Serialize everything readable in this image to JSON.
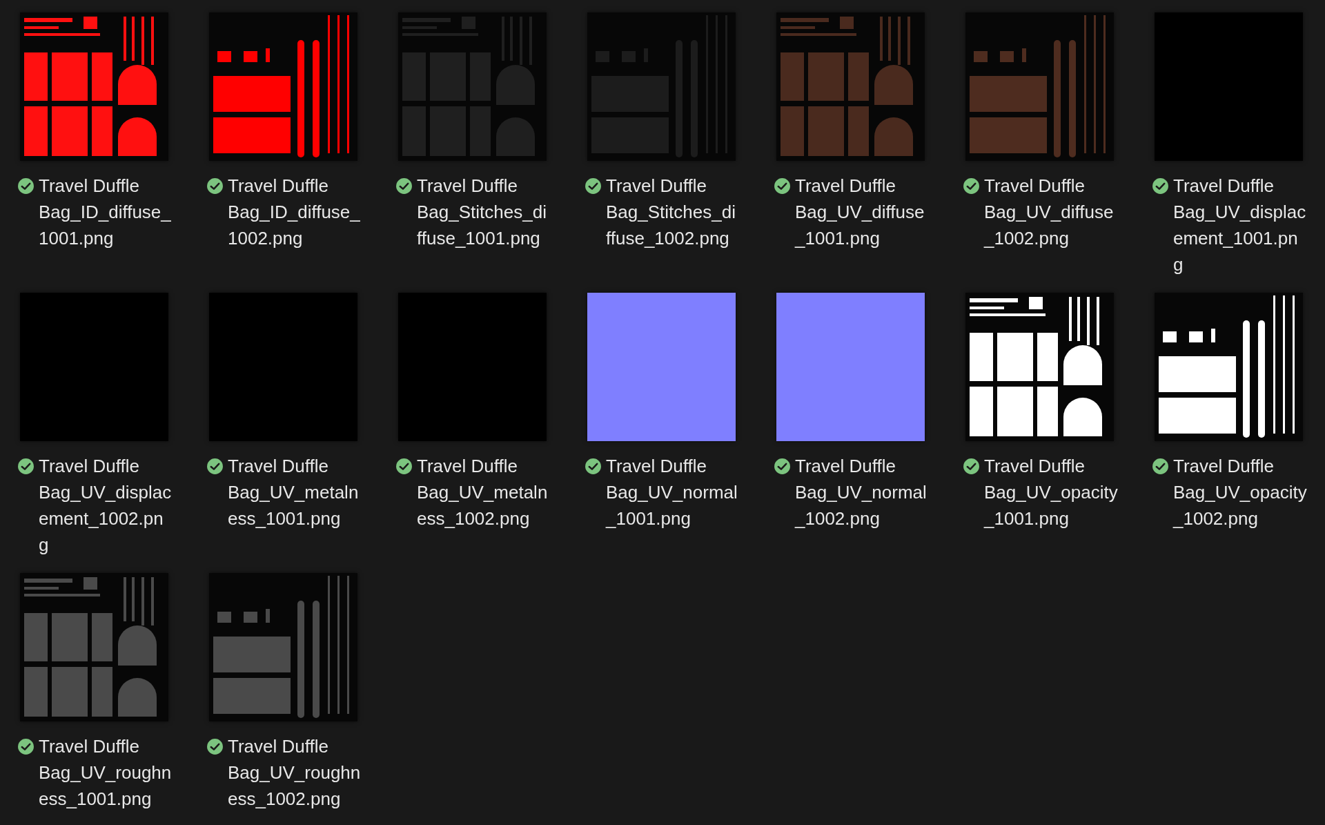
{
  "files": [
    {
      "name_lines": [
        "Travel Duffle",
        "Bag_ID_diffuse_",
        "1001.png"
      ],
      "synced": true,
      "thumbnail": {
        "kind": "grid",
        "color": "#ff1010"
      }
    },
    {
      "name_lines": [
        "Travel Duffle",
        "Bag_ID_diffuse_",
        "1002.png"
      ],
      "synced": true,
      "thumbnail": {
        "kind": "bars",
        "color": "#ff0000"
      }
    },
    {
      "name_lines": [
        "Travel Duffle",
        "Bag_Stitches_di",
        "ffuse_1001.png"
      ],
      "synced": true,
      "thumbnail": {
        "kind": "grid",
        "color": "#1f1f1f"
      }
    },
    {
      "name_lines": [
        "Travel Duffle",
        "Bag_Stitches_di",
        "ffuse_1002.png"
      ],
      "synced": true,
      "thumbnail": {
        "kind": "bars",
        "color": "#1c1c1c"
      }
    },
    {
      "name_lines": [
        "Travel Duffle",
        "Bag_UV_diffuse",
        "_1001.png"
      ],
      "synced": true,
      "thumbnail": {
        "kind": "grid",
        "color": "#4a2a1e"
      }
    },
    {
      "name_lines": [
        "Travel Duffle",
        "Bag_UV_diffuse",
        "_1002.png"
      ],
      "synced": true,
      "thumbnail": {
        "kind": "bars",
        "color": "#4e2c1f"
      }
    },
    {
      "name_lines": [
        "Travel Duffle",
        "Bag_UV_displac",
        "ement_1001.pn",
        "g"
      ],
      "synced": true,
      "thumbnail": {
        "kind": "flat",
        "color": "#000000"
      }
    },
    {
      "name_lines": [
        "Travel Duffle",
        "Bag_UV_displac",
        "ement_1002.pn",
        "g"
      ],
      "synced": true,
      "thumbnail": {
        "kind": "flat",
        "color": "#000000"
      }
    },
    {
      "name_lines": [
        "Travel Duffle",
        "Bag_UV_metaln",
        "ess_1001.png"
      ],
      "synced": true,
      "thumbnail": {
        "kind": "flat",
        "color": "#000000"
      }
    },
    {
      "name_lines": [
        "Travel Duffle",
        "Bag_UV_metaln",
        "ess_1002.png"
      ],
      "synced": true,
      "thumbnail": {
        "kind": "flat",
        "color": "#000000"
      }
    },
    {
      "name_lines": [
        "Travel Duffle",
        "Bag_UV_normal",
        "_1001.png"
      ],
      "synced": true,
      "thumbnail": {
        "kind": "flat",
        "color": "#7f7fff"
      }
    },
    {
      "name_lines": [
        "Travel Duffle",
        "Bag_UV_normal",
        "_1002.png"
      ],
      "synced": true,
      "thumbnail": {
        "kind": "flat",
        "color": "#7f7fff"
      }
    },
    {
      "name_lines": [
        "Travel Duffle",
        "Bag_UV_opacity",
        "_1001.png"
      ],
      "synced": true,
      "thumbnail": {
        "kind": "grid",
        "color": "#ffffff"
      }
    },
    {
      "name_lines": [
        "Travel Duffle",
        "Bag_UV_opacity",
        "_1002.png"
      ],
      "synced": true,
      "thumbnail": {
        "kind": "bars",
        "color": "#ffffff"
      }
    },
    {
      "name_lines": [
        "Travel Duffle",
        "Bag_UV_roughn",
        "ess_1001.png"
      ],
      "synced": true,
      "thumbnail": {
        "kind": "grid",
        "color": "#4a4a4a"
      }
    },
    {
      "name_lines": [
        "Travel Duffle",
        "Bag_UV_roughn",
        "ess_1002.png"
      ],
      "synced": true,
      "thumbnail": {
        "kind": "bars",
        "color": "#4a4a4a"
      }
    }
  ]
}
